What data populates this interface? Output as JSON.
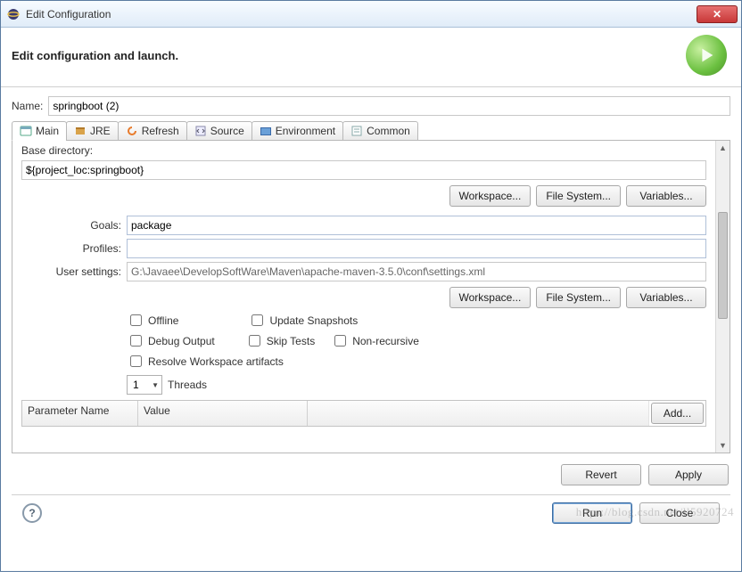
{
  "window": {
    "title": "Edit Configuration"
  },
  "banner": {
    "heading": "Edit configuration and launch."
  },
  "name": {
    "label": "Name:",
    "value": "springboot (2)"
  },
  "tabs": [
    {
      "label": "Main"
    },
    {
      "label": "JRE"
    },
    {
      "label": "Refresh"
    },
    {
      "label": "Source"
    },
    {
      "label": "Environment"
    },
    {
      "label": "Common"
    }
  ],
  "panel": {
    "base_dir_label": "Base directory:",
    "base_dir_value": "${project_loc:springboot}",
    "workspace_btn": "Workspace...",
    "filesystem_btn": "File System...",
    "variables_btn": "Variables...",
    "goals_label": "Goals:",
    "goals_value": "package",
    "profiles_label": "Profiles:",
    "profiles_value": "",
    "user_settings_label": "User settings:",
    "user_settings_value": "G:\\Javaee\\DevelopSoftWare\\Maven\\apache-maven-3.5.0\\conf\\settings.xml",
    "checks": {
      "offline": "Offline",
      "update_snapshots": "Update Snapshots",
      "debug_output": "Debug Output",
      "skip_tests": "Skip Tests",
      "non_recursive": "Non-recursive",
      "resolve_workspace": "Resolve Workspace artifacts"
    },
    "threads_value": "1",
    "threads_label": "Threads",
    "param_table": {
      "col_name": "Parameter Name",
      "col_value": "Value",
      "add_btn": "Add..."
    }
  },
  "actions": {
    "revert": "Revert",
    "apply": "Apply",
    "run": "Run",
    "close": "Close"
  },
  "watermark": "https://blog.csdn.net/ll5920724"
}
